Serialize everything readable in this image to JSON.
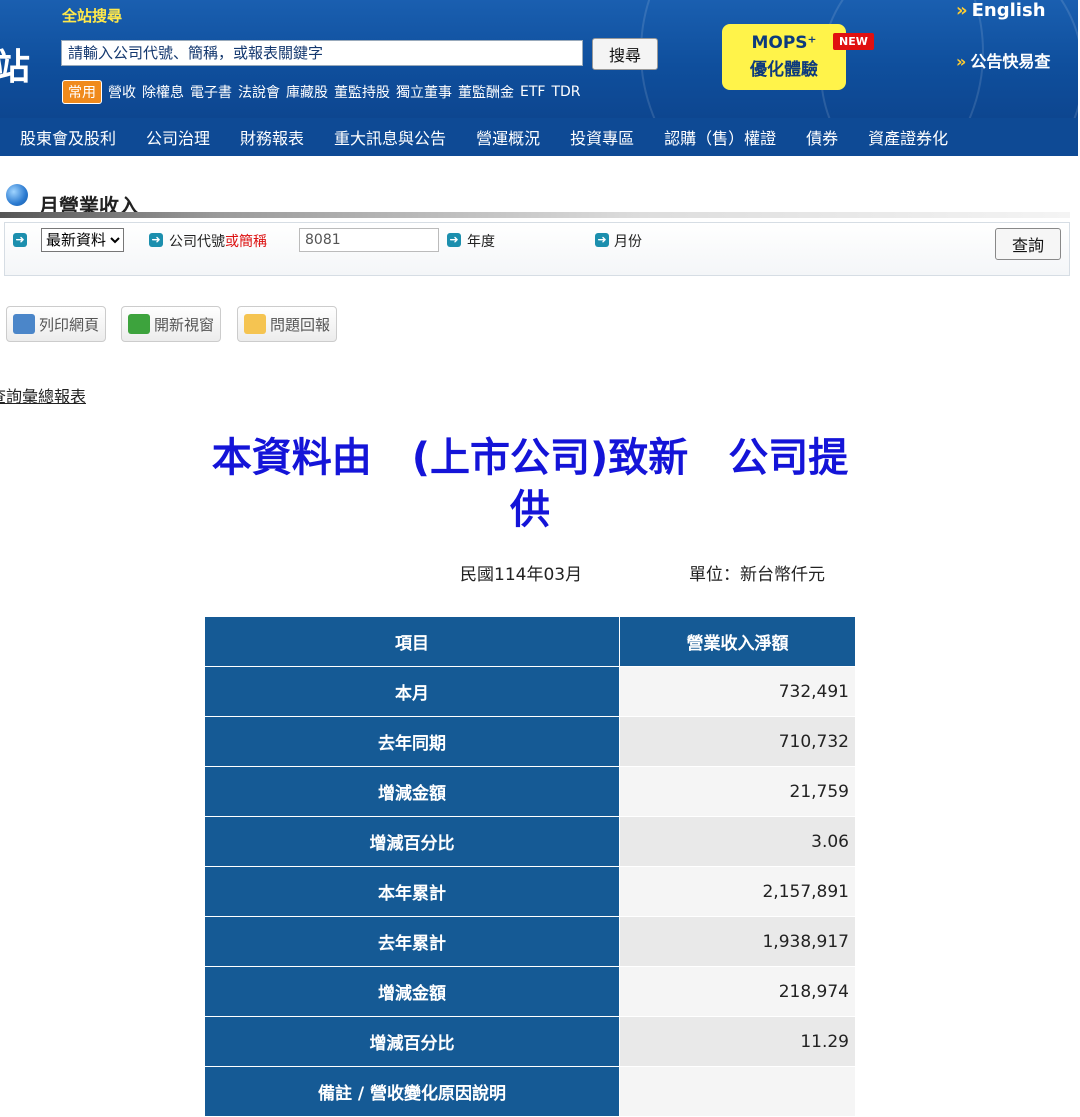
{
  "header": {
    "logo_glyph": "站",
    "site_search_label": "全站搜尋",
    "search_placeholder": "請輸入公司代號、簡稱，或報表關鍵字",
    "search_button": "搜尋",
    "common_tag": "常用",
    "quick_links": [
      "營收",
      "除權息",
      "電子書",
      "法說會",
      "庫藏股",
      "董監持股",
      "獨立董事",
      "董監酬金",
      "ETF",
      "TDR"
    ],
    "mops_line1": "MOPS⁺",
    "mops_line2": "優化體驗",
    "new_tag": "NEW",
    "english_link": "English",
    "announce_link": "公告快易查"
  },
  "nav": {
    "items": [
      "股東會及股利",
      "公司治理",
      "財務報表",
      "重大訊息與公告",
      "營運概況",
      "投資專區",
      "認購（售）權證",
      "債券",
      "資產證券化"
    ]
  },
  "section": {
    "title": "月營業收入"
  },
  "query": {
    "select_value": "最新資料",
    "code_label_prefix": "公司代號",
    "code_label_red": "或簡稱",
    "code_value": "8081",
    "year_label": "年度",
    "month_label": "月份",
    "submit": "查詢"
  },
  "tools": {
    "print": "列印網頁",
    "new_window": "開新視窗",
    "report": "問題回報"
  },
  "summary_link": "查詢彙總報表",
  "report": {
    "provider": "本資料由　(上市公司)致新　公司提供",
    "period": "民國114年03月",
    "unit": "單位：新台幣仟元",
    "col_item": "項目",
    "col_value": "營業收入淨額",
    "rows": [
      {
        "label": "本月",
        "value": "732,491"
      },
      {
        "label": "去年同期",
        "value": "710,732"
      },
      {
        "label": "增減金額",
        "value": "21,759"
      },
      {
        "label": "增減百分比",
        "value": "3.06"
      },
      {
        "label": "本年累計",
        "value": "2,157,891"
      },
      {
        "label": "去年累計",
        "value": "1,938,917"
      },
      {
        "label": "增減金額",
        "value": "218,974"
      },
      {
        "label": "增減百分比",
        "value": "11.29"
      },
      {
        "label": "備註 / 營收變化原因說明",
        "value": ""
      }
    ]
  }
}
